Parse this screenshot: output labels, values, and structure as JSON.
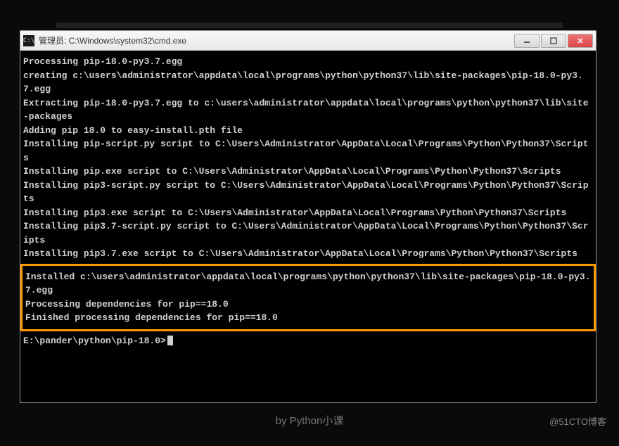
{
  "window": {
    "title": "管理员: C:\\Windows\\system32\\cmd.exe",
    "icon_label": "C:\\"
  },
  "terminal": {
    "lines": [
      "Processing pip-18.0-py3.7.egg",
      "creating c:\\users\\administrator\\appdata\\local\\programs\\python\\python37\\lib\\site-packages\\pip-18.0-py3.7.egg",
      "Extracting pip-18.0-py3.7.egg to c:\\users\\administrator\\appdata\\local\\programs\\python\\python37\\lib\\site-packages",
      "Adding pip 18.0 to easy-install.pth file",
      "Installing pip-script.py script to C:\\Users\\Administrator\\AppData\\Local\\Programs\\Python\\Python37\\Scripts",
      "Installing pip.exe script to C:\\Users\\Administrator\\AppData\\Local\\Programs\\Python\\Python37\\Scripts",
      "Installing pip3-script.py script to C:\\Users\\Administrator\\AppData\\Local\\Programs\\Python\\Python37\\Scripts",
      "Installing pip3.exe script to C:\\Users\\Administrator\\AppData\\Local\\Programs\\Python\\Python37\\Scripts",
      "Installing pip3.7-script.py script to C:\\Users\\Administrator\\AppData\\Local\\Programs\\Python\\Python37\\Scripts",
      "Installing pip3.7.exe script to C:\\Users\\Administrator\\AppData\\Local\\Programs\\Python\\Python37\\Scripts"
    ],
    "highlighted": [
      "",
      "Installed c:\\users\\administrator\\appdata\\local\\programs\\python\\python37\\lib\\site-packages\\pip-18.0-py3.7.egg",
      "Processing dependencies for pip==18.0",
      "Finished processing dependencies for pip==18.0"
    ],
    "prompt": "E:\\pander\\python\\pip-18.0>"
  },
  "watermarks": {
    "center": "by Python小课",
    "right": "@51CTO博客"
  }
}
